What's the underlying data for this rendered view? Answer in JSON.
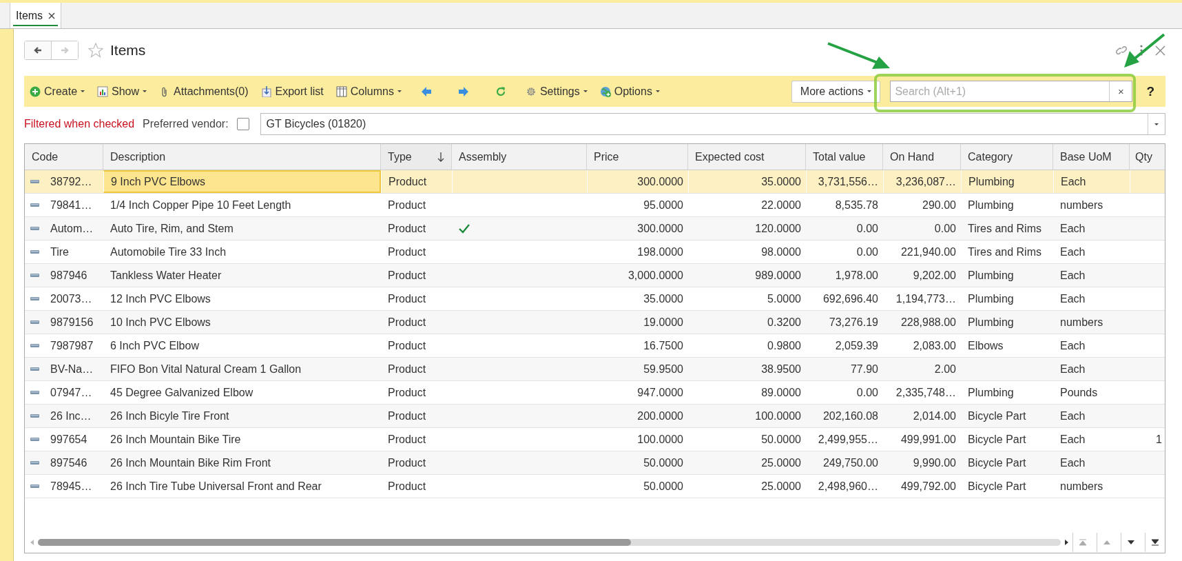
{
  "tabs": [
    {
      "label": "Items",
      "selected": true
    }
  ],
  "header": {
    "title": "Items",
    "favorite": false,
    "back_enabled": true,
    "forward_enabled": false
  },
  "toolbar": {
    "buttons": [
      {
        "label": "Create",
        "dropdown": true
      },
      {
        "label": "Show",
        "dropdown": true
      },
      {
        "label": "Attachments(0)",
        "dropdown": false
      },
      {
        "label": "Export list",
        "dropdown": false
      },
      {
        "label": "Columns",
        "dropdown": true
      },
      {
        "dropdown": false
      },
      {
        "dropdown": false
      },
      {
        "dropdown": false
      },
      {
        "label": "Settings",
        "dropdown": true
      },
      {
        "label": "Options",
        "dropdown": true
      }
    ],
    "more_actions": "More actions",
    "search": {
      "placeholder": "Search (Alt+1)"
    },
    "clear": "×",
    "help": "?"
  },
  "filter": {
    "note": "Filtered when checked",
    "label": "Preferred vendor:",
    "checked": false,
    "value": "GT Bicycles (01820)"
  },
  "table": {
    "columns": [
      {
        "label": "Code",
        "sorted": false
      },
      {
        "label": "Description",
        "sorted": false
      },
      {
        "label": "Type",
        "sorted": true
      },
      {
        "label": "Assembly",
        "sorted": false
      },
      {
        "label": "Price",
        "sorted": false
      },
      {
        "label": "Expected cost",
        "sorted": false
      },
      {
        "label": "Total value",
        "sorted": false
      },
      {
        "label": "On Hand",
        "sorted": false
      },
      {
        "label": "Category",
        "sorted": false
      },
      {
        "label": "Base UoM",
        "sorted": false
      },
      {
        "label": "Qty",
        "sorted": false
      }
    ],
    "rows": [
      {
        "selected": true,
        "cells": [
          "38792…",
          "9 Inch PVC Elbows",
          "Product",
          {
            "checked": false
          },
          "300.0000",
          "35.0000",
          "3,731,556…",
          "3,236,087…",
          "Plumbing",
          "Each"
        ]
      },
      {
        "selected": false,
        "cells": [
          "79841…",
          "1/4 Inch Copper Pipe 10 Feet Length",
          "Product",
          {
            "checked": false
          },
          "95.0000",
          "22.0000",
          "8,535.78",
          "290.00",
          "Plumbing",
          "numbers"
        ]
      },
      {
        "selected": false,
        "cells": [
          "Autom…",
          "Auto Tire, Rim, and Stem",
          "Product",
          {
            "checked": true
          },
          "300.0000",
          "120.0000",
          "0.00",
          "0.00",
          "Tires and Rims",
          "Each"
        ]
      },
      {
        "selected": false,
        "cells": [
          "Tire",
          "Automobile Tire 33 Inch",
          "Product",
          {
            "checked": false
          },
          "198.0000",
          "98.0000",
          "0.00",
          "221,940.00",
          "Tires and Rims",
          "Each"
        ]
      },
      {
        "selected": false,
        "cells": [
          "987946",
          "Tankless Water Heater",
          "Product",
          {
            "checked": false
          },
          "3,000.0000",
          "989.0000",
          "1,978.00",
          "9,202.00",
          "Plumbing",
          "Each"
        ]
      },
      {
        "selected": false,
        "cells": [
          "20073…",
          "12 Inch PVC Elbows",
          "Product",
          {
            "checked": false
          },
          "35.0000",
          "5.0000",
          "692,696.40",
          "1,194,773…",
          "Plumbing",
          "Each"
        ]
      },
      {
        "selected": false,
        "cells": [
          "9879156",
          "10 Inch PVC Elbows",
          "Product",
          {
            "checked": false
          },
          "19.0000",
          "0.3200",
          "73,276.19",
          "228,988.00",
          "Plumbing",
          "numbers"
        ]
      },
      {
        "selected": false,
        "cells": [
          "7987987",
          "6 Inch PVC Elbow",
          "Product",
          {
            "checked": false
          },
          "16.7500",
          "0.9800",
          "2,059.39",
          "2,083.00",
          "Elbows",
          "Each"
        ]
      },
      {
        "selected": false,
        "cells": [
          "BV-Na…",
          "FIFO Bon Vital Natural Cream 1 Gallon",
          "Product",
          {
            "checked": false
          },
          "59.9500",
          "38.9500",
          "77.90",
          "2.00",
          "",
          "Each"
        ]
      },
      {
        "selected": false,
        "cells": [
          "07947…",
          "45 Degree Galvanized Elbow",
          "Product",
          {
            "checked": false
          },
          "947.0000",
          "89.0000",
          "0.00",
          "2,335,748…",
          "Plumbing",
          "Pounds"
        ]
      },
      {
        "selected": false,
        "cells": [
          "26 Inc…",
          "26 Inch Bicyle Tire Front",
          "Product",
          {
            "checked": false
          },
          "200.0000",
          "100.0000",
          "202,160.08",
          "2,014.00",
          "Bicycle Part",
          "Each"
        ]
      },
      {
        "selected": false,
        "cells": [
          "997654",
          "26 Inch Mountain Bike Tire",
          "Product",
          {
            "checked": false
          },
          "100.0000",
          "50.0000",
          "2,499,955…",
          "499,991.00",
          "Bicycle Part",
          "Each",
          "1"
        ]
      },
      {
        "selected": false,
        "cells": [
          "897546",
          "26 Inch Mountain Bike Rim Front",
          "Product",
          {
            "checked": false
          },
          "50.0000",
          "25.0000",
          "249,750.00",
          "9,990.00",
          "Bicycle Part",
          "Each"
        ]
      },
      {
        "selected": false,
        "cells": [
          "78945…",
          "26 Inch Tire Tube Universal Front and Rear",
          "Product",
          {
            "checked": false
          },
          "50.0000",
          "25.0000",
          "2,498,960…",
          "499,792.00",
          "Bicycle Part",
          "numbers"
        ]
      }
    ]
  }
}
